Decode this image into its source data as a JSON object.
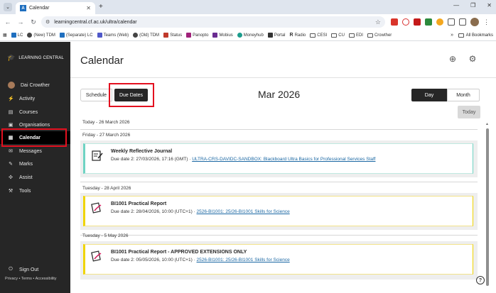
{
  "browser": {
    "tab_title": "Calendar",
    "url": "learningcentral.cf.ac.uk/ultra/calendar",
    "bookmarks": [
      "LC",
      "(New) TDM",
      "(Separate) LC",
      "Teams (Web)",
      "(Old) TDM",
      "Status",
      "Panopto",
      "Mobius",
      "Moneyhub",
      "Portal",
      "Radio",
      "CESI",
      "CU",
      "EDI",
      "Crowther"
    ],
    "all_bookmarks_label": "All Bookmarks"
  },
  "sidebar": {
    "logo_text": "LEARNING CENTRAL",
    "user_name": "Dai Crowther",
    "items": [
      {
        "label": "Activity",
        "icon": "activity-icon"
      },
      {
        "label": "Courses",
        "icon": "courses-icon"
      },
      {
        "label": "Organisations",
        "icon": "organisations-icon"
      },
      {
        "label": "Calendar",
        "icon": "calendar-icon"
      },
      {
        "label": "Messages",
        "icon": "messages-icon"
      },
      {
        "label": "Marks",
        "icon": "marks-icon"
      },
      {
        "label": "Assist",
        "icon": "assist-icon"
      },
      {
        "label": "Tools",
        "icon": "tools-icon"
      }
    ],
    "sign_out": "Sign Out",
    "footer": "Privacy • Terms • Accessibility"
  },
  "main": {
    "title": "Calendar",
    "tabs": {
      "schedule": "Schedule",
      "due_dates": "Due Dates"
    },
    "month": "Mar 2026",
    "view": {
      "day": "Day",
      "month": "Month"
    },
    "today_button": "Today",
    "today_label": "Today - 26 March 2026",
    "groups": [
      {
        "date": "Friday - 27 March 2026",
        "items": [
          {
            "title": "Weekly Reflective Journal",
            "due": "Due date 2: 27/03/2026, 17:16 (GMT) · ",
            "course": "ULTRA-CRS-DAVIDC-SANDBOX: Blackboard Ultra Basics for Professional Services Staff",
            "accent": "#6fd3c3"
          }
        ]
      },
      {
        "date": "Tuesday - 28 April 2026",
        "items": [
          {
            "title": "BI1001 Practical Report",
            "due": "Due date 2: 28/04/2026, 10:00 (UTC+1) · ",
            "course": "2526-BI1001: 25/26-BI1001 Skills for Science",
            "accent": "#f0d400"
          }
        ]
      },
      {
        "date": "Tuesday - 5 May 2026",
        "items": [
          {
            "title": "BI1001 Practical Report - APPROVED EXTENSIONS ONLY",
            "due": "Due date 2: 05/05/2026, 10:00 (UTC+1) · ",
            "course": "2526-BI1001: 25/26-BI1001 Skills for Science",
            "accent": "#f0d400"
          }
        ]
      }
    ]
  },
  "colors": {
    "highlight": "#e3101f",
    "sidebar_bg": "#262626",
    "link": "#1a67a3"
  }
}
